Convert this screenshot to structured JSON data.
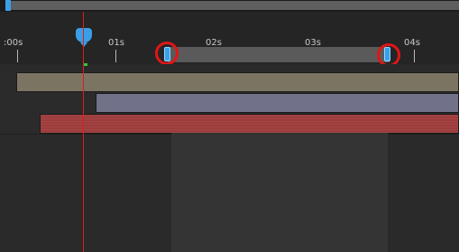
{
  "timeline": {
    "ruler_labels": [
      ":00s",
      "01s",
      "02s",
      "03s",
      "04s"
    ],
    "colors": {
      "background": "#232323",
      "playhead": "#e11b1b",
      "accent": "#3a9fe6",
      "annotation": "#e01616",
      "layer_1": "#7b7462",
      "layer_2": "#72718a",
      "layer_3": "#9e3c3c"
    },
    "icons": [
      "navigator-handle-icon",
      "time-indicator-icon",
      "work-area-start-handle-icon",
      "work-area-end-handle-icon"
    ]
  }
}
